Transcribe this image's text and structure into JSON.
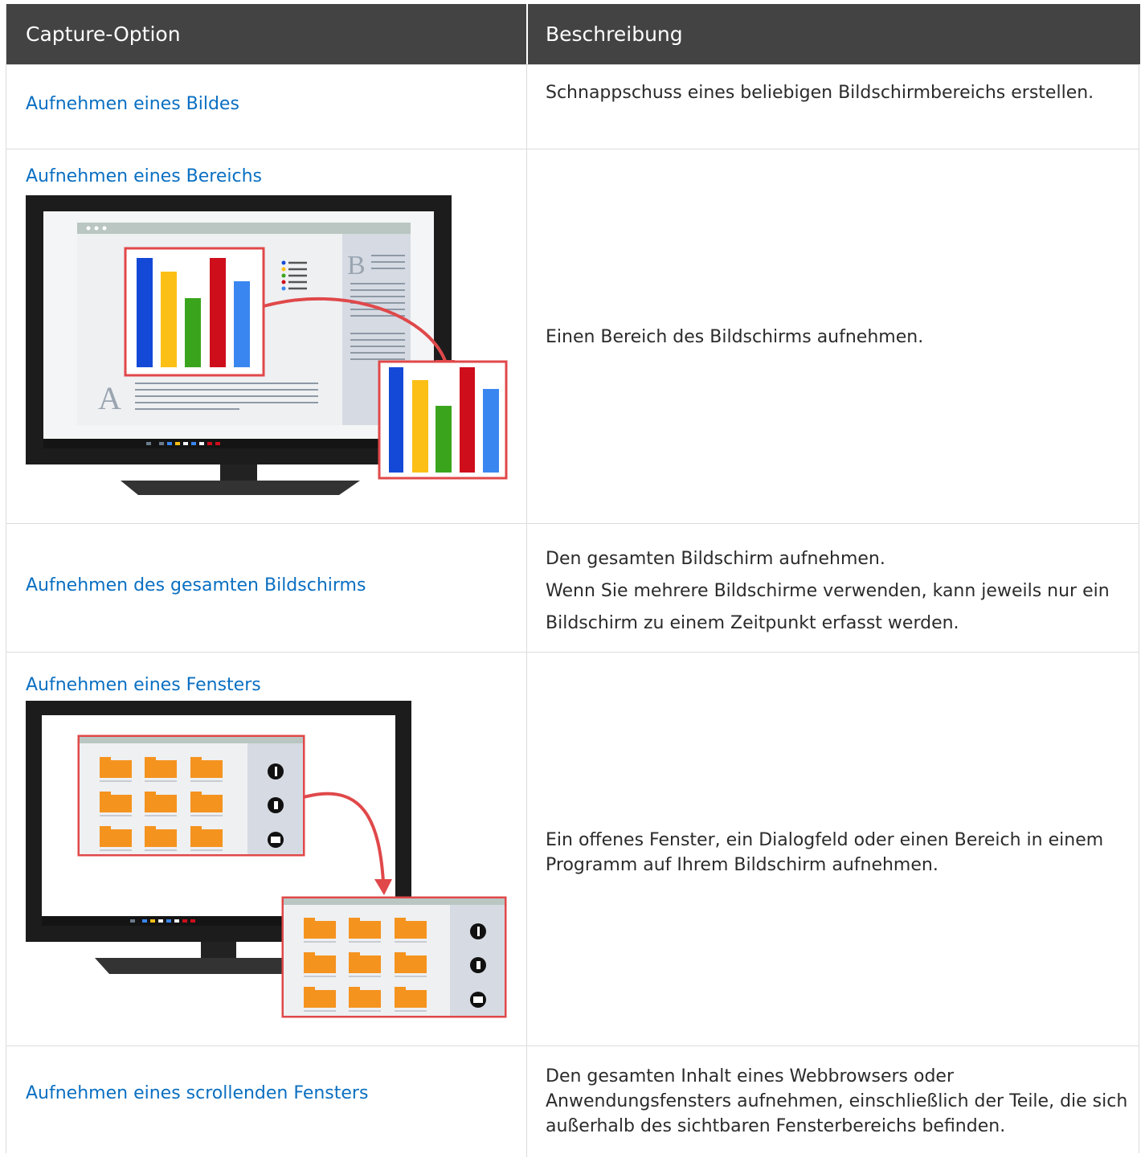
{
  "header": {
    "col1": "Capture-Option",
    "col2": "Beschreibung"
  },
  "rows": [
    {
      "option": "Aufnehmen eines Bildes",
      "desc": [
        "Schnappschuss eines beliebigen Bildschirmbereichs erstellen."
      ]
    },
    {
      "option": "Aufnehmen eines Bereichs",
      "desc": [
        "Einen Bereich des Bildschirms aufnehmen."
      ]
    },
    {
      "option": "Aufnehmen des gesamten Bildschirms",
      "desc": [
        "Den gesamten Bildschirm aufnehmen.",
        "Wenn Sie mehrere Bildschirme verwenden, kann jeweils nur ein Bildschirm zu einem Zeitpunkt erfasst werden."
      ]
    },
    {
      "option": "Aufnehmen eines Fensters",
      "desc": [
        "Ein offenes Fenster, ein Dialogfeld oder einen Bereich in einem Programm auf Ihrem Bildschirm aufnehmen."
      ]
    },
    {
      "option": "Aufnehmen eines scrollenden Fensters",
      "desc": [
        "Den gesamten Inhalt eines Webbrowsers oder Anwendungsfensters aufnehmen, einschließlich der Teile, die sich außerhalb des sichtbaren Fensterbereichs befinden."
      ]
    }
  ],
  "illustrations": {
    "region_letters": [
      "A",
      "B"
    ],
    "accent_color": "#e0484a",
    "bar_colors": [
      "#1449d8",
      "#fbbf16",
      "#3aa51c",
      "#cf0e1c",
      "#3a86f0"
    ],
    "folder_color": "#f5931f"
  }
}
